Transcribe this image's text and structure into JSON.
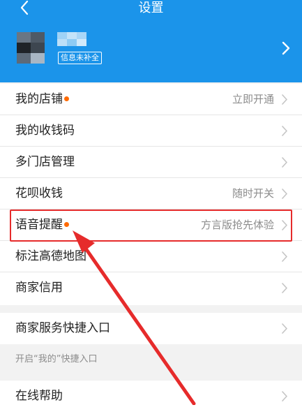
{
  "header": {
    "title": "设置",
    "badge": "信息未补全",
    "background": "#1b94ea"
  },
  "group1": [
    {
      "label": "我的店铺",
      "dot": true,
      "value": "立即开通"
    },
    {
      "label": "我的收钱码",
      "dot": false,
      "value": ""
    },
    {
      "label": "多门店管理",
      "dot": false,
      "value": ""
    },
    {
      "label": "花呗收钱",
      "dot": false,
      "value": "随时开关"
    },
    {
      "label": "语音提醒",
      "dot": true,
      "value": "方言版抢先体验"
    },
    {
      "label": "标注高德地图",
      "dot": false,
      "value": ""
    },
    {
      "label": "商家信用",
      "dot": false,
      "value": ""
    }
  ],
  "group2": [
    {
      "label": "商家服务快捷入口",
      "dot": false,
      "value": ""
    }
  ],
  "group2_note": "开启“我的”快捷入口",
  "group3": [
    {
      "label": "在线帮助",
      "dot": false,
      "value": ""
    }
  ],
  "annotation": {
    "highlight_color": "#e62b2b",
    "arrow_color": "#e62b2b"
  }
}
